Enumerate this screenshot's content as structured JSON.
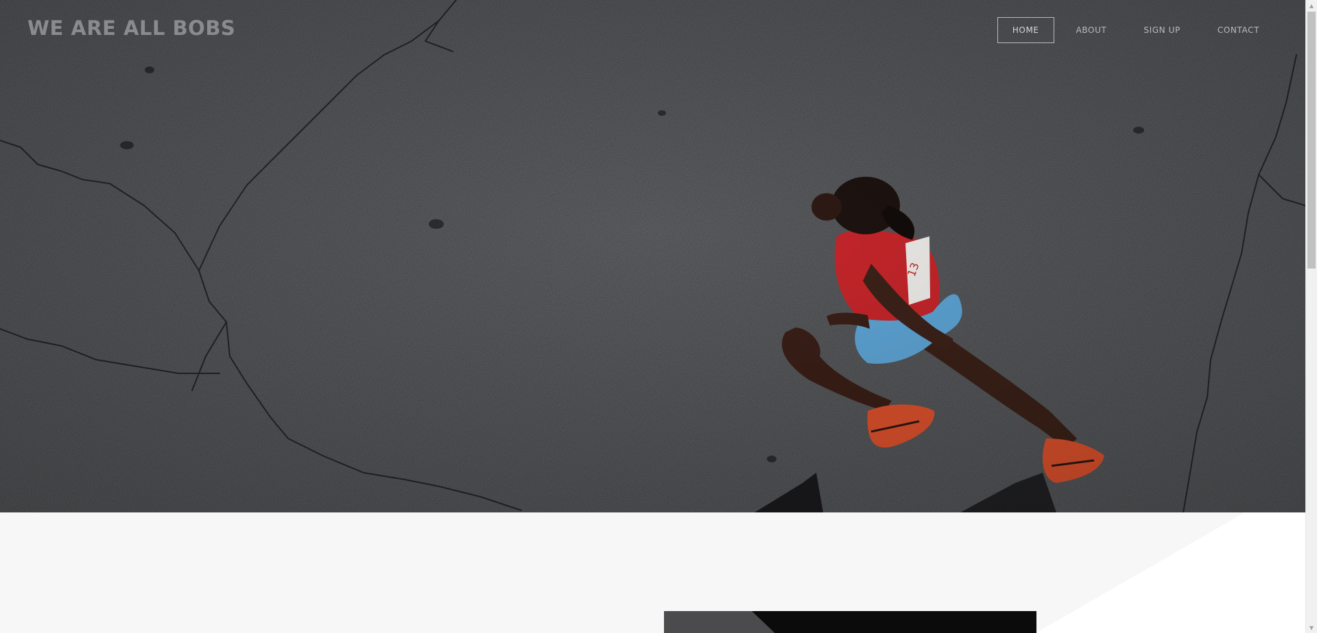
{
  "site": {
    "brand": "WE ARE ALL BOBS"
  },
  "nav": {
    "items": [
      {
        "label": "HOME",
        "active": true
      },
      {
        "label": "ABOUT",
        "active": false
      },
      {
        "label": "SIGN UP",
        "active": false
      },
      {
        "label": "CONTACT",
        "active": false
      }
    ]
  },
  "hero": {
    "image": "aerial-runner-on-asphalt",
    "runner_bib": "13"
  },
  "colors": {
    "asphalt": "#3c3d40",
    "nav_text": "#b9babc",
    "brand_text": "#8a8b8e",
    "section_bg": "#f7f7f7",
    "singlet_red": "#c8262b",
    "shorts_blue": "#5fa7d9",
    "shoe_orange": "#e0522d"
  },
  "icons": {
    "scroll_up": "scroll-up-arrow-icon",
    "scroll_down": "scroll-down-arrow-icon"
  }
}
